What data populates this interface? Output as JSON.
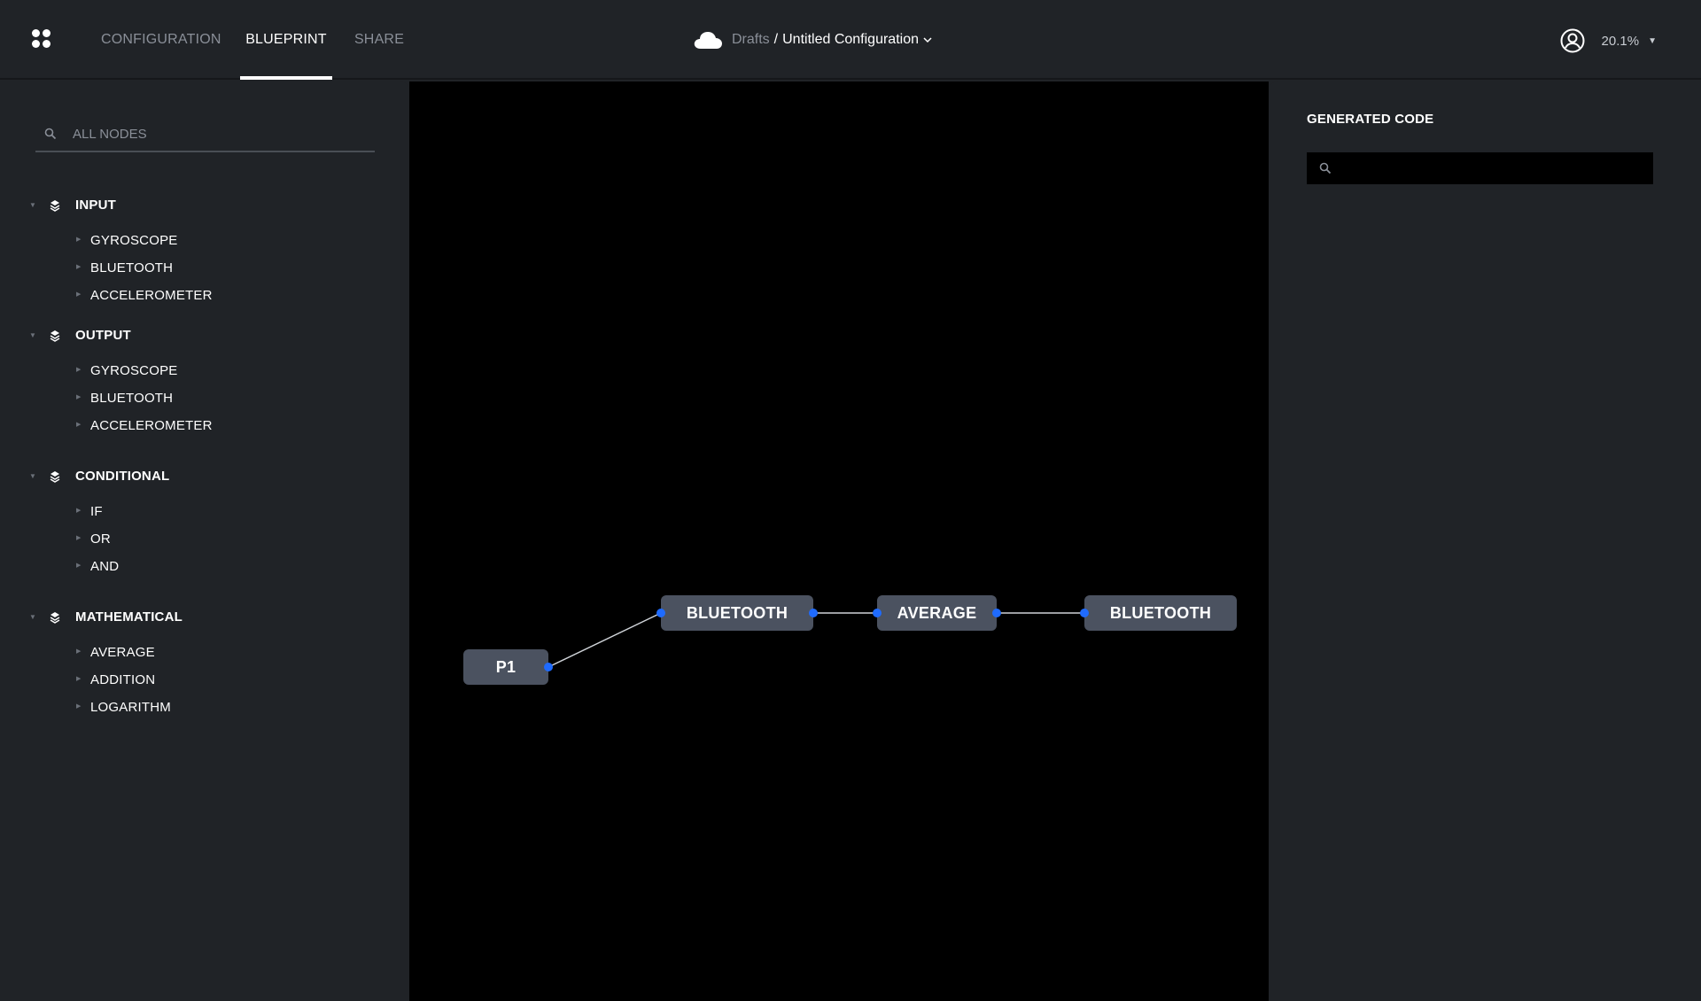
{
  "header": {
    "tabs": [
      {
        "label": "CONFIGURATION",
        "active": false
      },
      {
        "label": "BLUEPRINT",
        "active": true
      },
      {
        "label": "SHARE",
        "active": false
      }
    ],
    "breadcrumb": {
      "folder": "Drafts",
      "separator": "/",
      "title": "Untitled Configuration"
    },
    "zoom": "20.1%",
    "icons": [
      "apps-grid-icon",
      "cloud-icon",
      "chevron-down-icon",
      "user-circle-icon",
      "caret-down-icon"
    ]
  },
  "sidebar": {
    "search_placeholder": "ALL NODES",
    "groups": [
      {
        "title": "INPUT",
        "items": [
          "GYROSCOPE",
          "BLUETOOTH",
          "ACCELEROMETER"
        ]
      },
      {
        "title": "OUTPUT",
        "items": [
          "GYROSCOPE",
          "BLUETOOTH",
          "ACCELEROMETER"
        ]
      },
      {
        "title": "CONDITIONAL",
        "items": [
          "IF",
          "OR",
          "AND"
        ]
      },
      {
        "title": "MATHEMATICAL",
        "items": [
          "AVERAGE",
          "ADDITION",
          "LOGARITHM"
        ]
      }
    ]
  },
  "canvas": {
    "nodes": [
      {
        "id": "p1",
        "label": "P1"
      },
      {
        "id": "bt1",
        "label": "BLUETOOTH"
      },
      {
        "id": "avg",
        "label": "AVERAGE"
      },
      {
        "id": "bt2",
        "label": "BLUETOOTH"
      }
    ],
    "links": [
      [
        "p1",
        "bt1"
      ],
      [
        "bt1",
        "avg"
      ],
      [
        "avg",
        "bt2"
      ]
    ],
    "port_color": "#1f6bff",
    "node_color": "#4b5260"
  },
  "code_panel": {
    "title": "GENERATED CODE",
    "search_value": ""
  }
}
